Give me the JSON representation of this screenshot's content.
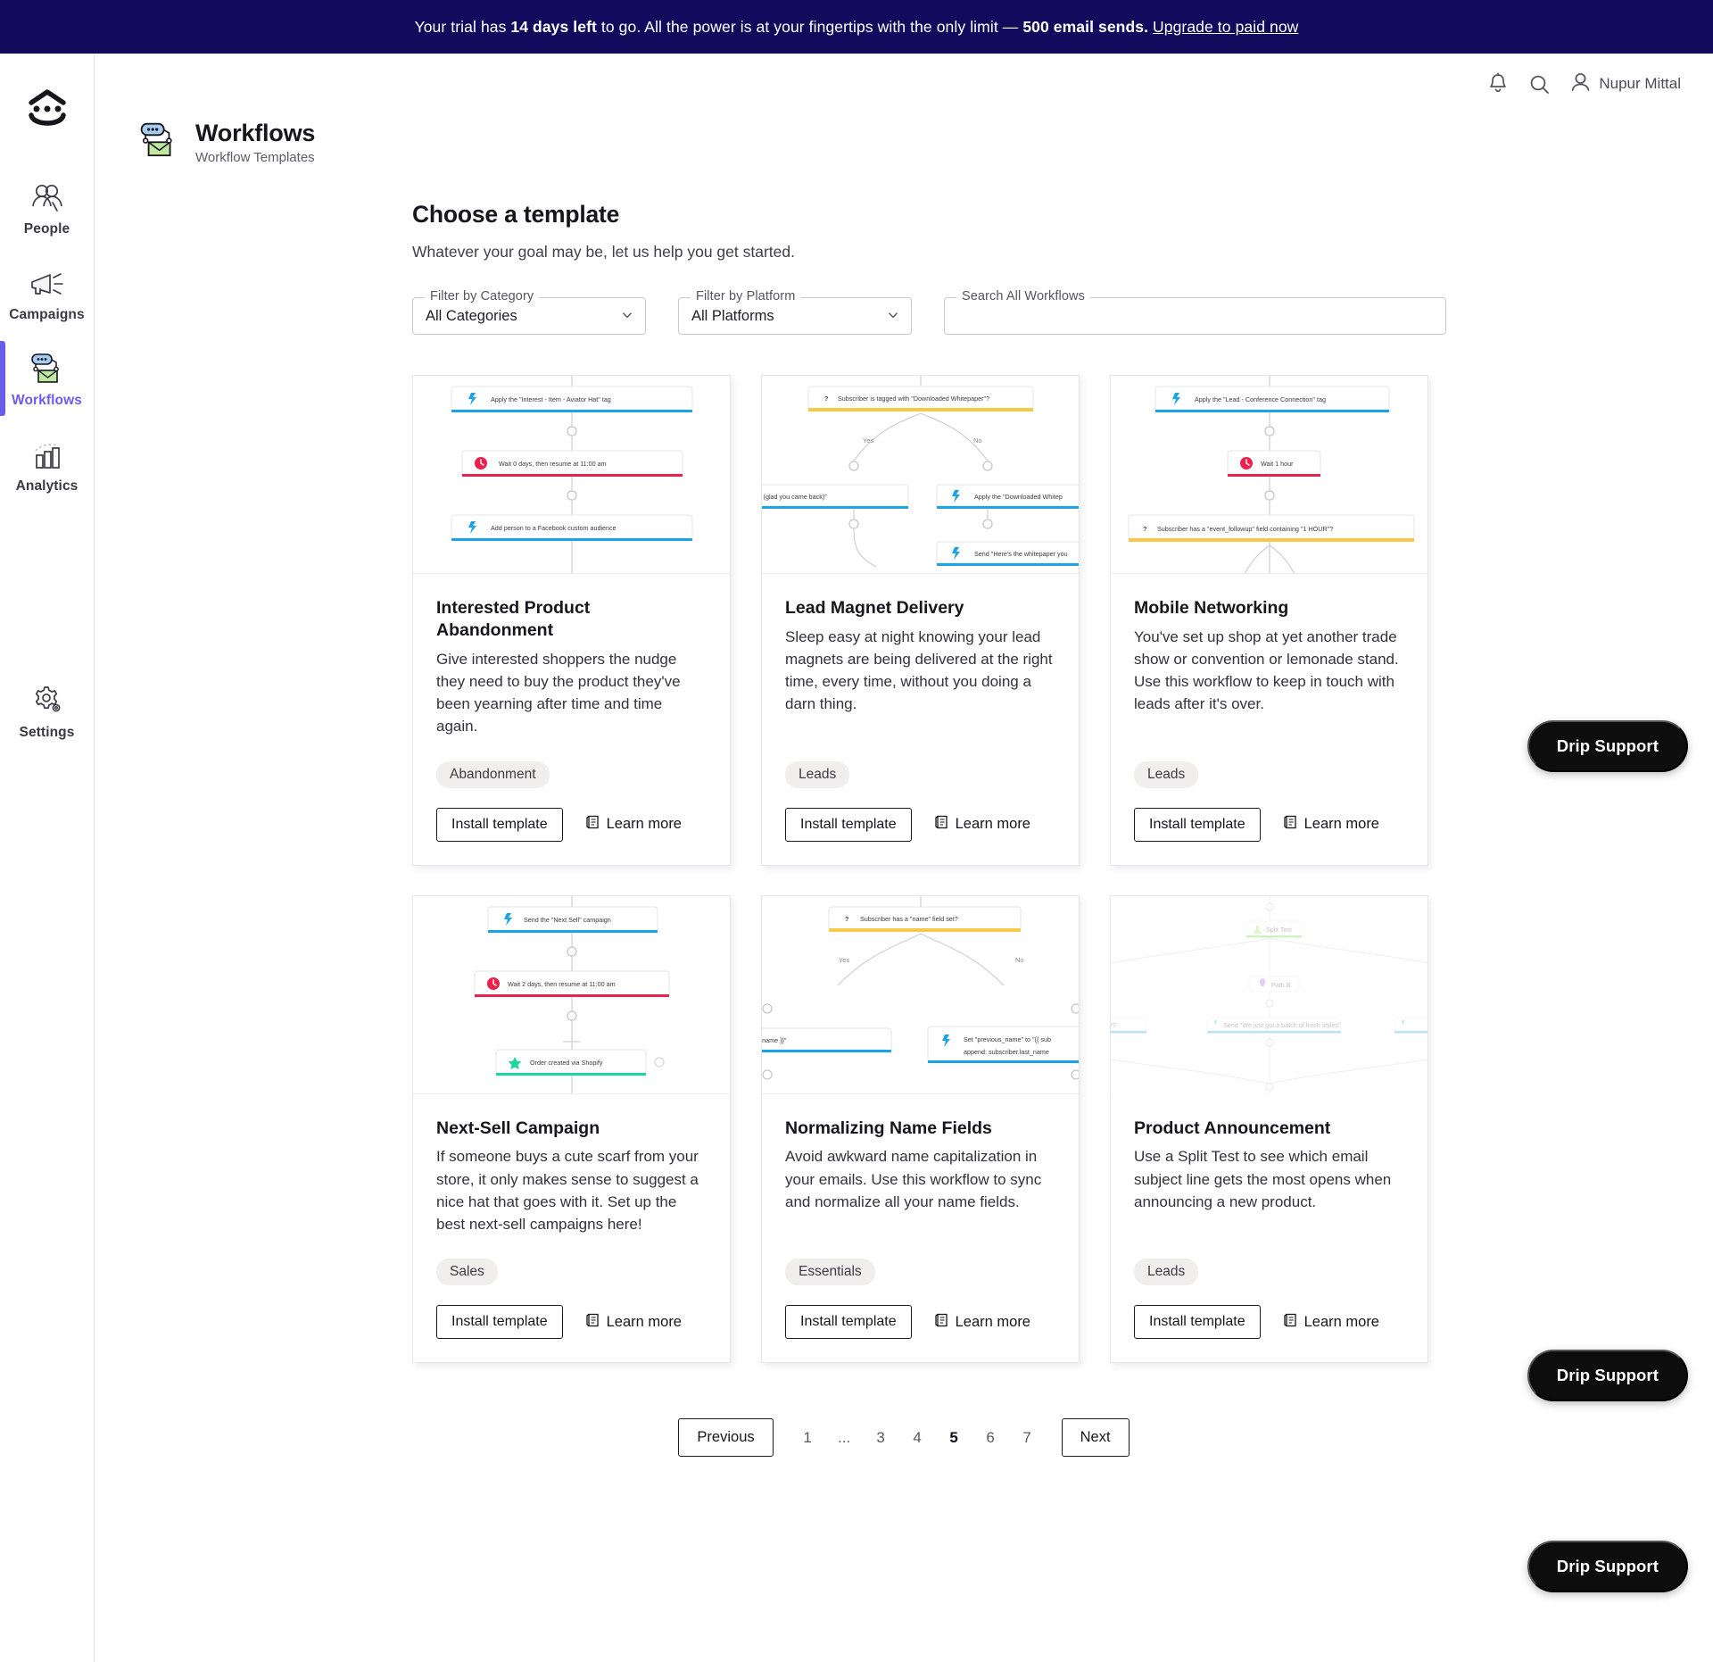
{
  "banner": {
    "prefix": "Your trial has ",
    "days": "14 days left",
    "middle": " to go. All the power is at your fingertips with the only limit — ",
    "limit": "500 email sends.",
    "link": "Upgrade to paid now"
  },
  "sidebar": {
    "logo_icon": "drip-smiley-logo",
    "items": [
      {
        "label": "People",
        "icon": "people-icon",
        "active": false
      },
      {
        "label": "Campaigns",
        "icon": "megaphone-icon",
        "active": false
      },
      {
        "label": "Workflows",
        "icon": "workflow-chat-envelope-icon",
        "active": true
      },
      {
        "label": "Analytics",
        "icon": "bar-chart-icon",
        "active": false
      },
      {
        "label": "Settings",
        "icon": "gear-icon",
        "active": false
      }
    ],
    "accent_color": "#6c5ce7"
  },
  "topbar": {
    "notifications_icon": "bell-icon",
    "search_icon": "search-icon",
    "avatar_icon": "user-icon",
    "user_name": "Nupur Mittal"
  },
  "page_header": {
    "icon": "workflow-chat-envelope-icon",
    "title": "Workflows",
    "subtitle": "Workflow Templates"
  },
  "content": {
    "heading": "Choose a template",
    "subheading": "Whatever your goal may be, let us help you get started."
  },
  "filters": {
    "category": {
      "legend": "Filter by Category",
      "value": "All Categories"
    },
    "platform": {
      "legend": "Filter by Platform",
      "value": "All Platforms"
    },
    "search": {
      "legend": "Search All Workflows",
      "value": "",
      "placeholder": ""
    }
  },
  "buttons": {
    "install": "Install template",
    "learn_more": "Learn more"
  },
  "cards": [
    {
      "title": "Interested Product Abandonment",
      "description": "Give interested shoppers the nudge they need to buy the product they've been yearning after time and time again.",
      "tag": "Abandonment",
      "thumb": {
        "type": "linear",
        "nodes": [
          {
            "text": "Apply the \"Interest - Item - Aviator Hat\" tag",
            "icon": "bolt",
            "accent": "#1aa3e8"
          },
          {
            "text": "Wait 0 days, then resume at 11:00 am",
            "icon": "clock",
            "accent": "#e8224c"
          },
          {
            "text": "Add person to a Facebook custom audience",
            "icon": "bolt",
            "accent": "#1aa3e8"
          }
        ]
      }
    },
    {
      "title": "Lead Magnet Delivery",
      "description": "Sleep easy at night knowing your lead magnets are being delivered at the right time, every time, without you doing a darn thing.",
      "tag": "Leads",
      "thumb": {
        "type": "branch",
        "decision": "Subscriber is tagged with \"Downloaded Whitepaper\"?",
        "yes_label": "Yes",
        "no_label": "No",
        "yes_node": "r whitepaper (glad you came back)\"",
        "no_node": "Apply the \"Downloaded Whitep",
        "no_node2": "Send \"Here's the whitepaper you"
      }
    },
    {
      "title": "Mobile Networking",
      "description": "You've set up shop at yet another trade show or convention or lemonade stand. Use this workflow to keep in touch with leads after it's over.",
      "tag": "Leads",
      "thumb": {
        "type": "linear",
        "nodes": [
          {
            "text": "Apply the \"Lead - Conference Connection\" tag",
            "icon": "bolt",
            "accent": "#1aa3e8"
          },
          {
            "text": "Wait 1 hour",
            "icon": "clock",
            "accent": "#e8224c"
          },
          {
            "text": "Subscriber has a \"event_followup\" field containing \"1 HOUR\"?",
            "icon": "question",
            "accent": "#f7c948"
          }
        ]
      }
    },
    {
      "title": "Next-Sell Campaign",
      "description": "If someone buys a cute scarf from your store, it only makes sense to suggest a nice hat that goes with it. Set up the best next-sell campaigns here!",
      "tag": "Sales",
      "thumb": {
        "type": "linear",
        "nodes": [
          {
            "text": "Send the \"Next Sell\" campaign",
            "icon": "bolt",
            "accent": "#1aa3e8"
          },
          {
            "text": "Wait 2 days, then resume at 11:00 am",
            "icon": "clock",
            "accent": "#e8224c"
          },
          {
            "text": "Order created via Shopify",
            "icon": "star",
            "accent": "#1fd6a0"
          }
        ]
      }
    },
    {
      "title": "Normalizing Name Fields",
      "description": "Avoid awkward name capitalization in your emails. Use this workflow to sync and normalize all your name fields.",
      "tag": "Essentials",
      "thumb": {
        "type": "branch",
        "decision": "Subscriber has a \"name\" field set?",
        "yes_label": "Yes",
        "no_label": "No",
        "yes_node": "to \"{{ subscriber.name }}\"",
        "no_node": "Set \"previous_name\" to \"{{ sub",
        "no_node2": "append: subscriber.last_name"
      }
    },
    {
      "title": "Product Announcement",
      "description": "Use a Split Test to see which email subject line gets the most opens when announcing a new product.",
      "tag": "Leads",
      "thumb": {
        "type": "split",
        "faded": true,
        "nodes": [
          {
            "text": "Split Test",
            "accent": "#66d62a"
          },
          {
            "text": "Path B",
            "accent": "#b05ce0"
          },
          {
            "text": "Send \"We just got a batch of fresh styles\"",
            "accent": "#1aa3e8"
          },
          {
            "text": "ntable?",
            "accent": "#1aa3e8"
          }
        ]
      }
    }
  ],
  "pagination": {
    "previous": "Previous",
    "next": "Next",
    "pages": [
      "1",
      "...",
      "3",
      "4",
      "5",
      "6",
      "7"
    ],
    "current": "5"
  },
  "support": {
    "label": "Drip Support",
    "count": 3
  }
}
